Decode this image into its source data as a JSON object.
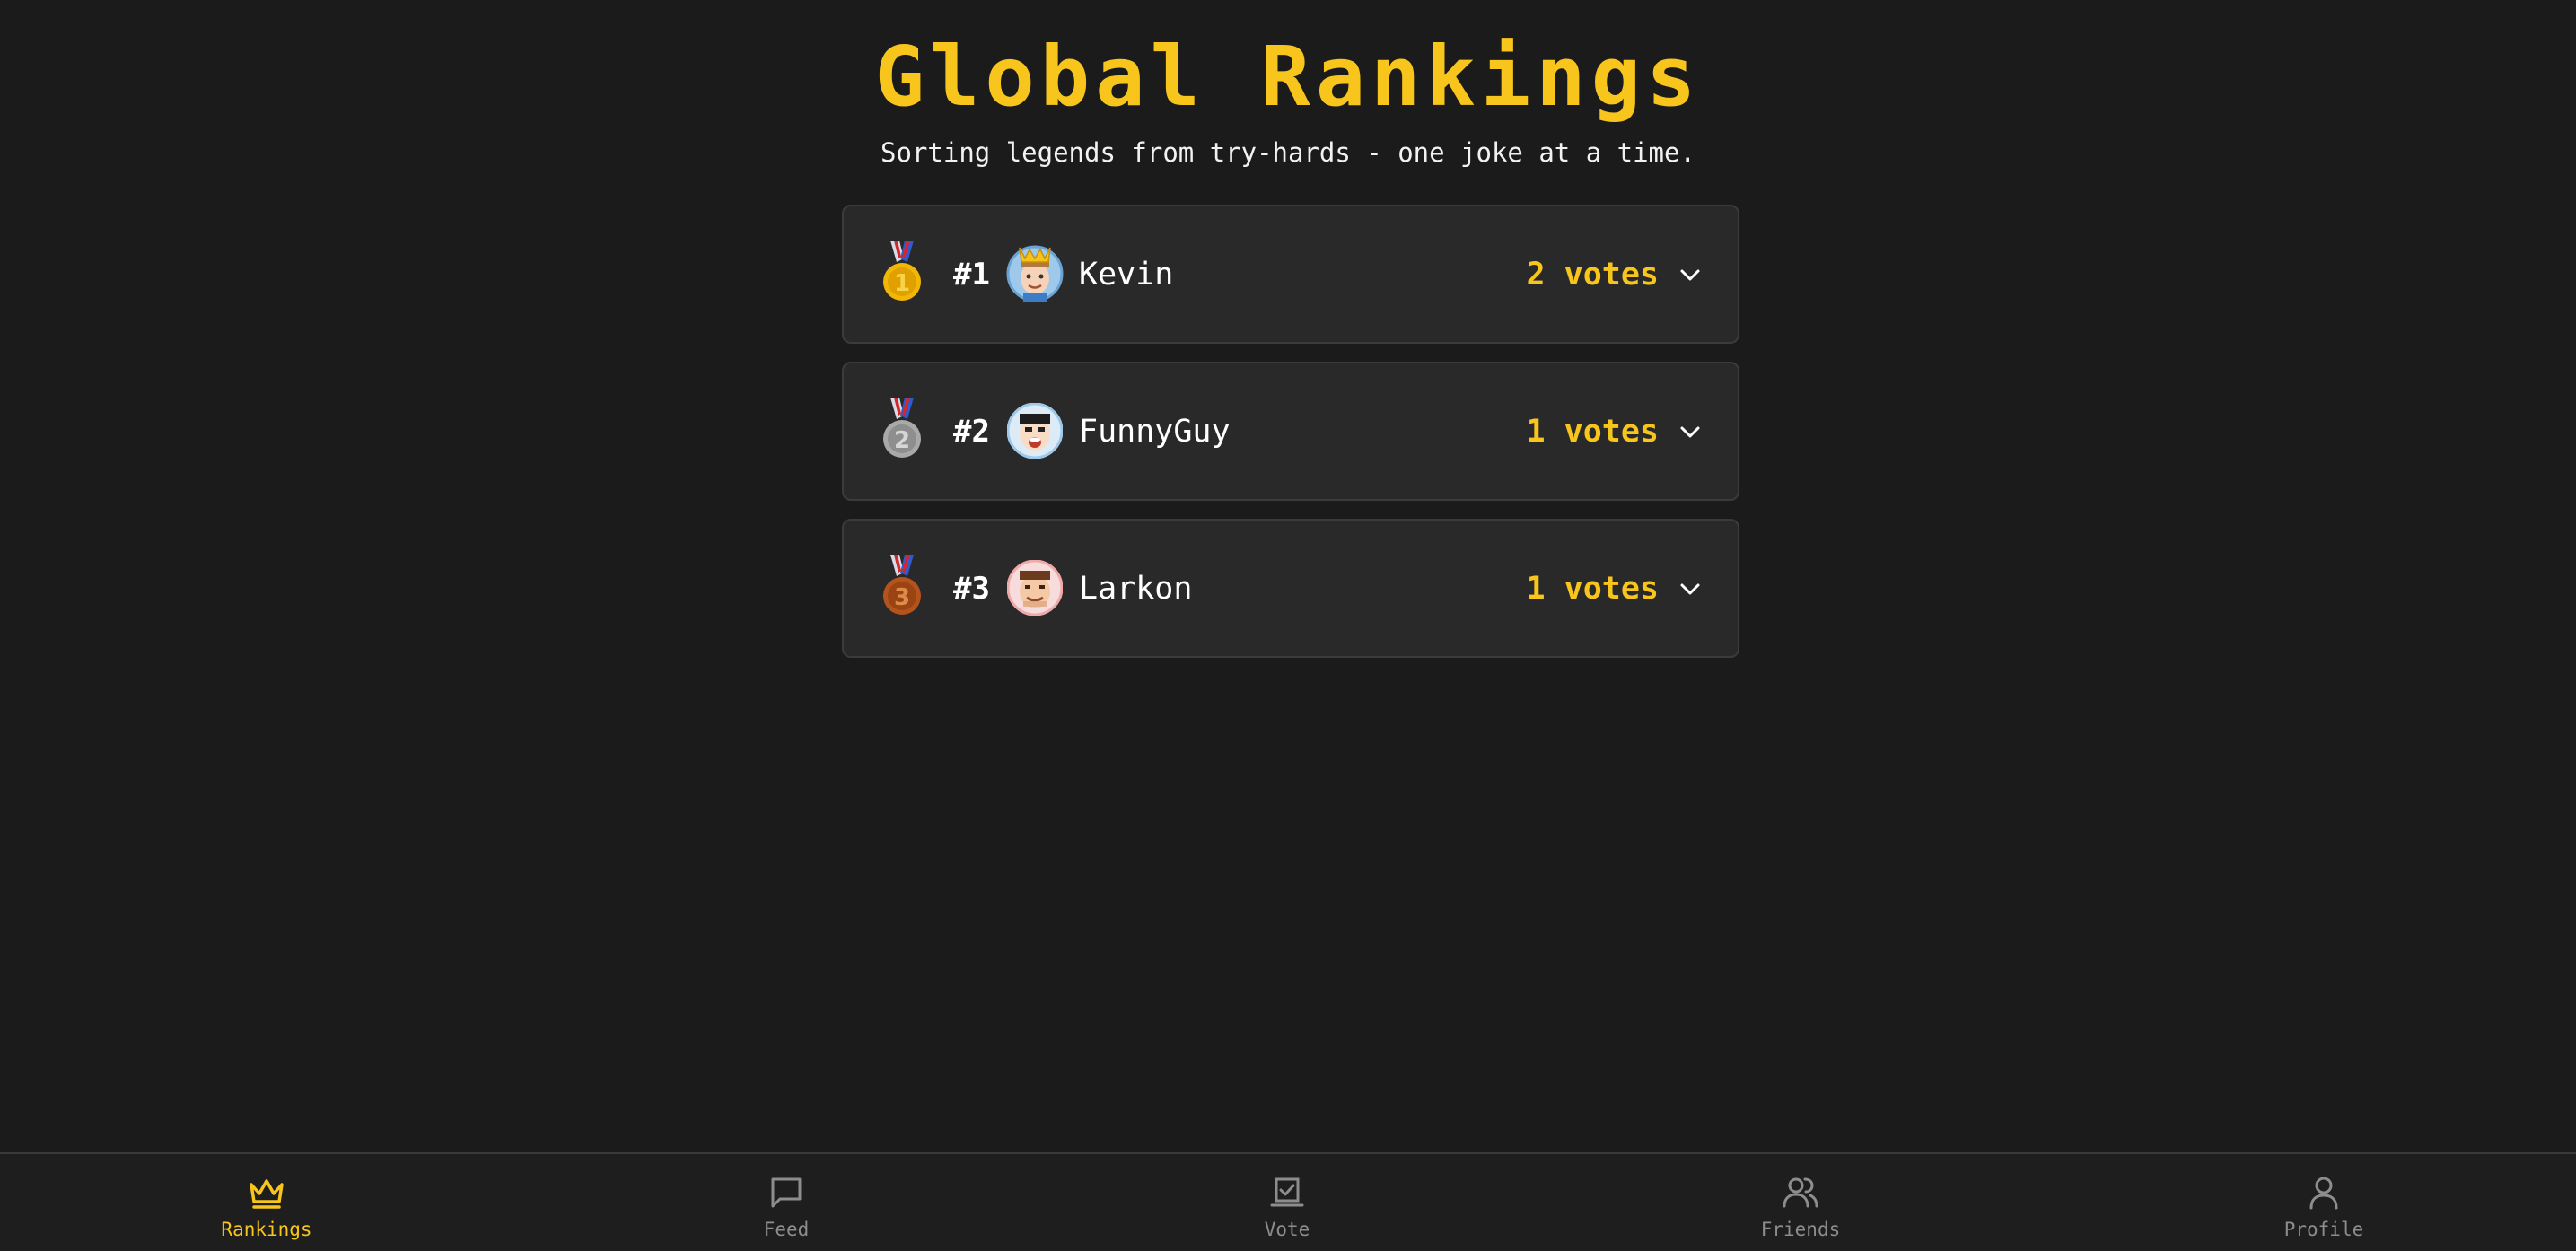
{
  "header": {
    "title": "Global Rankings",
    "subtitle": "Sorting legends from try-hards - one joke at a time."
  },
  "rankings": [
    {
      "rank_label": "#1",
      "name": "Kevin",
      "votes_label": "2 votes",
      "medal_digit": "1",
      "medal": "gold-medal-icon",
      "avatar": "kevin-avatar-with-crown"
    },
    {
      "rank_label": "#2",
      "name": "FunnyGuy",
      "votes_label": "1 votes",
      "medal_digit": "2",
      "medal": "silver-medal-icon",
      "avatar": "funnyguy-avatar"
    },
    {
      "rank_label": "#3",
      "name": "Larkon",
      "votes_label": "1 votes",
      "medal_digit": "3",
      "medal": "bronze-medal-icon",
      "avatar": "larkon-avatar"
    }
  ],
  "tabbar": {
    "active": "Rankings",
    "tabs": [
      {
        "label": "Rankings",
        "icon": "crown-icon"
      },
      {
        "label": "Feed",
        "icon": "chat-bubble-icon"
      },
      {
        "label": "Vote",
        "icon": "ballot-box-icon"
      },
      {
        "label": "Friends",
        "icon": "users-icon"
      },
      {
        "label": "Profile",
        "icon": "user-icon"
      }
    ]
  },
  "colors": {
    "background": "#1b1b1b",
    "card": "#292929",
    "accent": "#f7c51c",
    "muted": "#8d8d8d",
    "gold": "#f2b705",
    "silver": "#a9a9a9",
    "bronze": "#b5531c"
  }
}
